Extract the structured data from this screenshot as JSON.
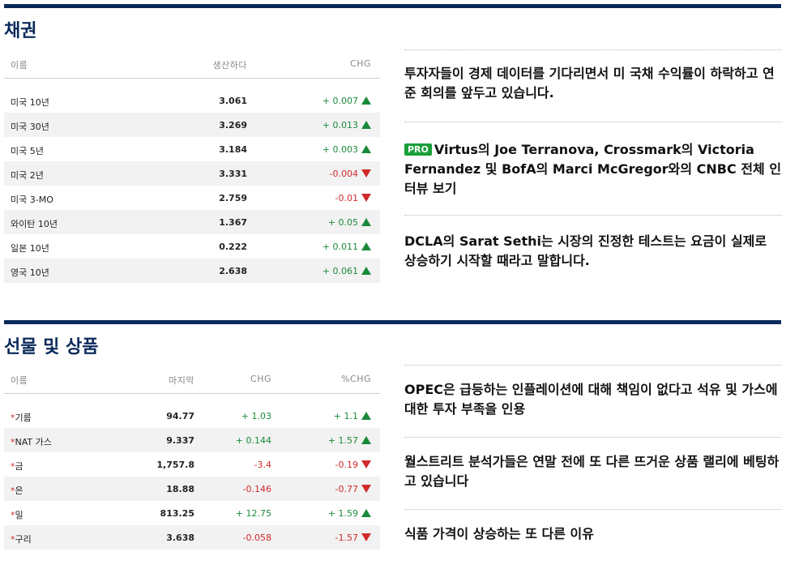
{
  "bonds": {
    "title": "채권",
    "headers": {
      "name": "이름",
      "yield": "생산하다",
      "chg": "CHG"
    },
    "rows": [
      {
        "name": "미국 10년",
        "yield": "3.061",
        "chg": "+ 0.007",
        "dir": "up"
      },
      {
        "name": "미국 30년",
        "yield": "3.269",
        "chg": "+ 0.013",
        "dir": "up"
      },
      {
        "name": "미국 5년",
        "yield": "3.184",
        "chg": "+ 0.003",
        "dir": "up"
      },
      {
        "name": "미국 2년",
        "yield": "3.331",
        "chg": "-0.004",
        "dir": "down"
      },
      {
        "name": "미국 3-MO",
        "yield": "2.759",
        "chg": "-0.01",
        "dir": "down"
      },
      {
        "name": "와이탄 10년",
        "yield": "1.367",
        "chg": "+ 0.05",
        "dir": "up"
      },
      {
        "name": "일본 10년",
        "yield": "0.222",
        "chg": "+ 0.011",
        "dir": "up"
      },
      {
        "name": "영국 10년",
        "yield": "2.638",
        "chg": "+ 0.061",
        "dir": "up"
      }
    ],
    "news": [
      {
        "pro": false,
        "text": "투자자들이 경제 데이터를 기다리면서 미 국채 수익률이 하락하고 연준 회의를 앞두고 있습니다."
      },
      {
        "pro": true,
        "pro_label": "PRO",
        "text": "Virtus의 Joe Terranova, Crossmark의 Victoria Fernandez 및 BofA의 Marci McGregor와의 CNBC 전체 인터뷰 보기"
      },
      {
        "pro": false,
        "text": "DCLA의 Sarat Sethi는 시장의 진정한 테스트는 요금이 실제로 상승하기 시작할 때라고 말합니다."
      }
    ]
  },
  "futures": {
    "title": "선물 및 상품",
    "headers": {
      "name": "이름",
      "last": "마지막",
      "chg": "CHG",
      "pct": "%CHG"
    },
    "rows": [
      {
        "marker": "*",
        "name": "기름",
        "last": "94.77",
        "chg": "+ 1.03",
        "pct": "+ 1.1",
        "dir": "up"
      },
      {
        "marker": "*",
        "name": "NAT 가스",
        "last": "9.337",
        "chg": "+ 0.144",
        "pct": "+ 1.57",
        "dir": "up"
      },
      {
        "marker": "*",
        "name": "금",
        "last": "1,757.8",
        "chg": "-3.4",
        "pct": "-0.19",
        "dir": "down"
      },
      {
        "marker": "*",
        "name": "은",
        "last": "18.88",
        "chg": "-0.146",
        "pct": "-0.77",
        "dir": "down"
      },
      {
        "marker": "*",
        "name": "밀",
        "last": "813.25",
        "chg": "+ 12.75",
        "pct": "+ 1.59",
        "dir": "up"
      },
      {
        "marker": "*",
        "name": "구리",
        "last": "3.638",
        "chg": "-0.058",
        "pct": "-1.57",
        "dir": "down"
      }
    ],
    "news": [
      {
        "text": "OPEC은 급등하는 인플레이션에 대해 책임이 없다고 석유 및 가스에 대한 투자 부족을 인용"
      },
      {
        "text": "월스트리트 분석가들은 연말 전에 또 다른 뜨거운 상품 랠리에 베팅하고 있습니다"
      },
      {
        "text": "식품 가격이 상승하는 또 다른 이유"
      }
    ]
  },
  "colors": {
    "navy": "#0b2a5b",
    "up": "#1a8a3a",
    "down": "#d02a2a",
    "pro": "#1a9e3a"
  }
}
